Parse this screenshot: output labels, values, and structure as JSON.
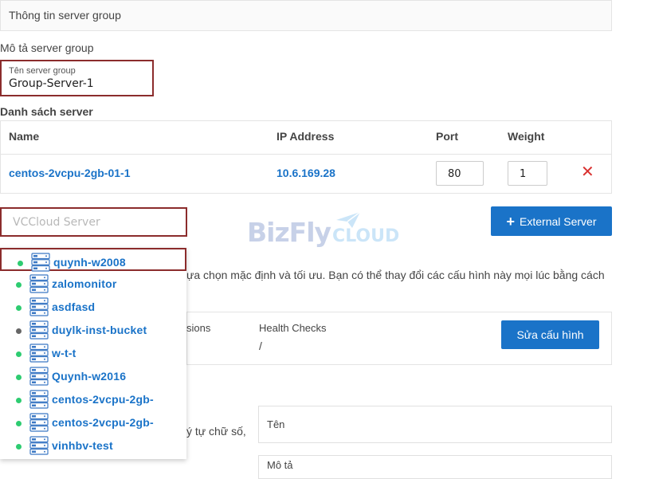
{
  "header": {
    "title": "Thông tin server group"
  },
  "description": {
    "label": "Mô tả server group"
  },
  "group_name": {
    "label": "Tên server group",
    "value": "Group-Server-1"
  },
  "server_list": {
    "title": "Danh sách server",
    "columns": {
      "name": "Name",
      "ip": "IP Address",
      "port": "Port",
      "weight": "Weight"
    },
    "rows": [
      {
        "name": "centos-2vcpu-2gb-01-1",
        "ip": "10.6.169.28",
        "port": "80",
        "weight": "1"
      }
    ]
  },
  "search": {
    "placeholder": "VCCloud Server",
    "value": ""
  },
  "external_button": {
    "label": "External Server"
  },
  "logo": {
    "text": "BizFly",
    "suffix": "CLOUD"
  },
  "info": {
    "line1": "ựa chọn mặc định và tối ưu. Bạn có thể thay đổi các cấu hình này mọi lúc bằng cách"
  },
  "config": {
    "col1_label": "sions",
    "health_checks_label": "Health Checks",
    "health_checks_value": "/",
    "edit_button": "Sửa cấu hình"
  },
  "bottom": {
    "hint": "ý tự chữ số,",
    "name_field": "Tên",
    "desc_field": "Mô tả"
  },
  "dropdown": {
    "items": [
      {
        "name": "quynh-w2008",
        "status": "online"
      },
      {
        "name": "zalomonitor",
        "status": "online"
      },
      {
        "name": "asdfasd",
        "status": "online"
      },
      {
        "name": "duylk-inst-bucket",
        "status": "offline"
      },
      {
        "name": "w-t-t",
        "status": "online"
      },
      {
        "name": "Quynh-w2016",
        "status": "online"
      },
      {
        "name": "centos-2vcpu-2gb-",
        "status": "online"
      },
      {
        "name": "centos-2vcpu-2gb-",
        "status": "online"
      },
      {
        "name": "vinhbv-test",
        "status": "online"
      }
    ]
  },
  "colors": {
    "accent": "#1a73c8",
    "danger": "#d9302f",
    "highlight_border": "#8b2c2c",
    "online": "#2ecc71",
    "offline": "#666666"
  }
}
